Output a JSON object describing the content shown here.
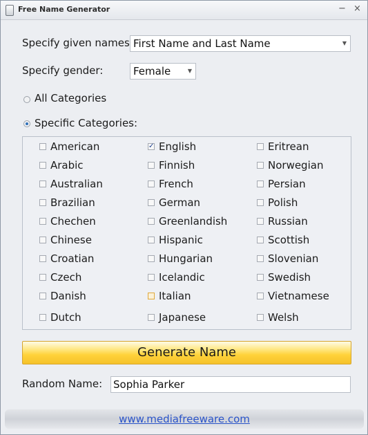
{
  "window": {
    "title": "Free Name Generator",
    "minimize_glyph": "−",
    "close_glyph": "×"
  },
  "form": {
    "given_names_label": "Specify given names:",
    "given_names_value": "First Name and Last Name",
    "gender_label": "Specify gender:",
    "gender_value": "Female",
    "all_categories_label": "All Categories",
    "specific_categories_label": "Specific Categories:",
    "selected_mode": "specific"
  },
  "categories": {
    "col1": [
      "American",
      "Arabic",
      "Australian",
      "Brazilian",
      "Chechen",
      "Chinese",
      "Croatian",
      "Czech",
      "Danish",
      "Dutch"
    ],
    "col2": [
      "English",
      "Finnish",
      "French",
      "German",
      "Greenlandish",
      "Hispanic",
      "Hungarian",
      "Icelandic",
      "Italian",
      "Japanese"
    ],
    "col3": [
      "Eritrean",
      "Norwegian",
      "Persian",
      "Polish",
      "Russian",
      "Scottish",
      "Slovenian",
      "Swedish",
      "Vietnamese",
      "Welsh"
    ],
    "checked": [
      "English"
    ],
    "hot": [
      "Italian"
    ]
  },
  "generate_button_label": "Generate Name",
  "random_name_label": "Random Name:",
  "random_name_value": "Sophia Parker",
  "footer_link": "www.mediafreeware.com",
  "icons": {
    "combo_arrow": "▼",
    "check": "✓"
  },
  "colors": {
    "button_gold": "#ffd23a",
    "link_blue": "#2a54c9",
    "radio_dot": "#2f6fb8"
  }
}
